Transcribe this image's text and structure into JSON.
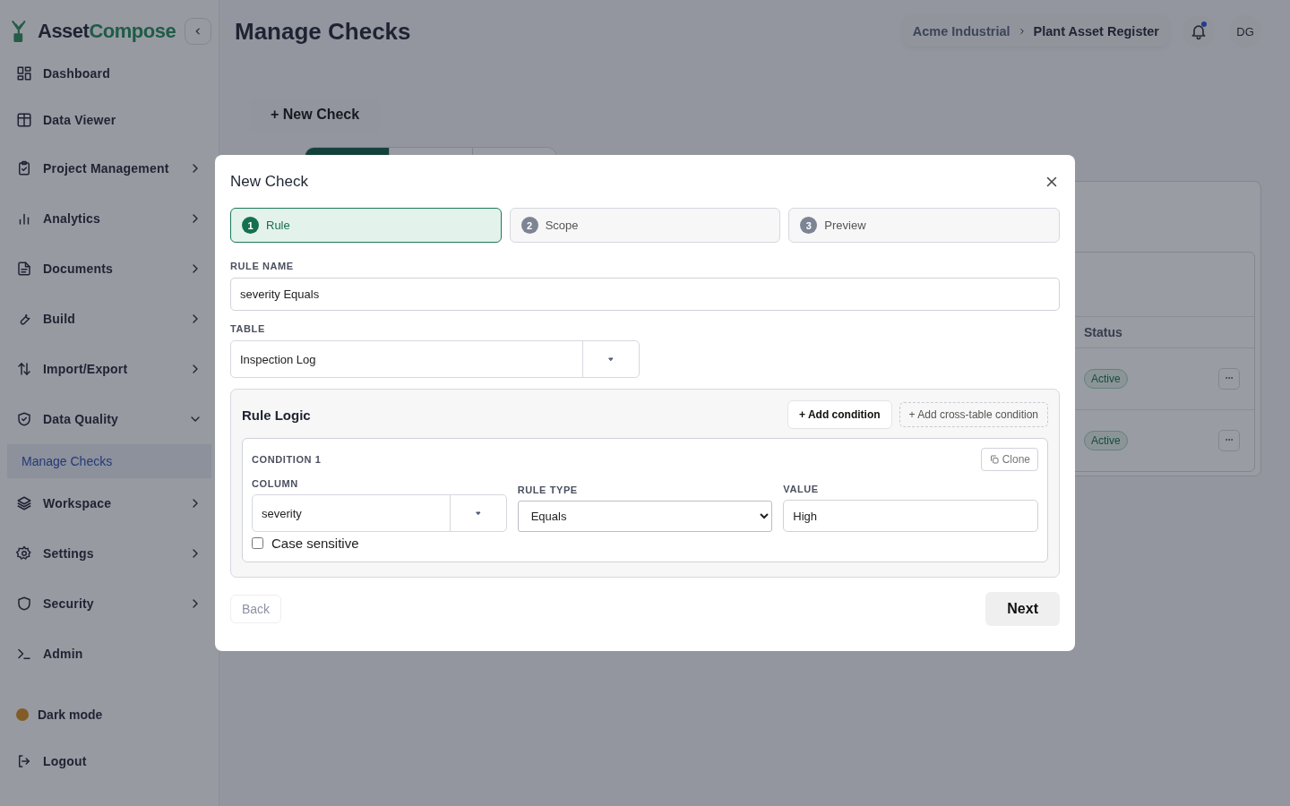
{
  "brand": {
    "first": "Asset",
    "second": "Compose"
  },
  "sidebar": {
    "items": [
      {
        "kind": "link",
        "label": "Dashboard"
      },
      {
        "kind": "link",
        "label": "Data Viewer"
      },
      {
        "kind": "group",
        "label": "Project Management",
        "expanded": false
      },
      {
        "kind": "group",
        "label": "Analytics",
        "expanded": false
      },
      {
        "kind": "group",
        "label": "Documents",
        "expanded": false
      },
      {
        "kind": "group",
        "label": "Build",
        "expanded": false
      },
      {
        "kind": "group",
        "label": "Import/Export",
        "expanded": false
      },
      {
        "kind": "group",
        "label": "Data Quality",
        "expanded": true,
        "children": [
          {
            "label": "Manage Checks",
            "selected": true
          }
        ]
      },
      {
        "kind": "group",
        "label": "Workspace",
        "expanded": false
      },
      {
        "kind": "group",
        "label": "Settings",
        "expanded": false
      },
      {
        "kind": "group",
        "label": "Security",
        "expanded": false
      },
      {
        "kind": "link",
        "label": "Admin"
      }
    ],
    "dark_mode": {
      "label": "Dark mode",
      "on": false
    },
    "logout": {
      "label": "Logout"
    }
  },
  "header": {
    "title": "Manage Checks",
    "breadcrumb": [
      "Acme Industrial",
      "Plant Asset Register"
    ],
    "has_unread": true,
    "avatar": "DG"
  },
  "new_check_button": "+ New Check",
  "tabs": [
    {
      "selected": true
    },
    {
      "selected": false
    },
    {
      "selected": false
    }
  ],
  "table": {
    "columns": [
      "Status"
    ],
    "rows": [
      {
        "status": "Active"
      },
      {
        "status": "Active"
      }
    ]
  },
  "modal": {
    "title": "New Check",
    "steps": [
      {
        "number": "1",
        "label": "Rule",
        "selected": true
      },
      {
        "number": "2",
        "label": "Scope",
        "selected": false
      },
      {
        "number": "3",
        "label": "Preview",
        "selected": false
      }
    ],
    "rule_name": {
      "label": "RULE NAME",
      "value": "severity Equals"
    },
    "table_field": {
      "label": "TABLE",
      "value": "Inspection Log"
    },
    "rule_logic": {
      "title": "Rule Logic",
      "add_condition": "+ Add condition",
      "add_cross": "+ Add cross-table condition",
      "conditions": [
        {
          "title": "CONDITION 1",
          "clone": "Clone",
          "column_label": "COLUMN",
          "column": "severity",
          "rule_type_label": "RULE TYPE",
          "rule_type": "Equals",
          "value_label": "VALUE",
          "value": "High",
          "case_sensitive": {
            "label": "Case sensitive",
            "checked": false
          }
        }
      ]
    },
    "back": {
      "label": "Back",
      "disabled": true
    },
    "next": "Next"
  }
}
